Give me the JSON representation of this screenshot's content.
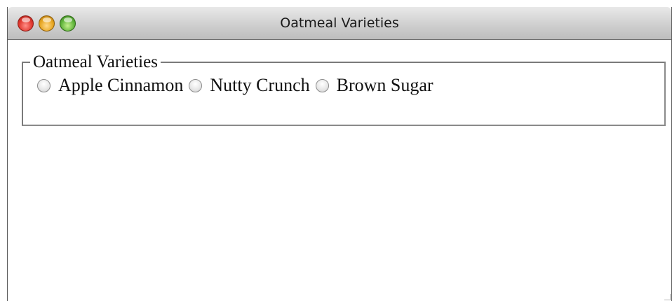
{
  "window": {
    "title": "Oatmeal Varieties"
  },
  "fieldset": {
    "legend": "Oatmeal Varieties",
    "options": [
      {
        "label": "Apple Cinnamon",
        "checked": false
      },
      {
        "label": "Nutty Crunch",
        "checked": false
      },
      {
        "label": "Brown Sugar",
        "checked": false
      }
    ]
  }
}
